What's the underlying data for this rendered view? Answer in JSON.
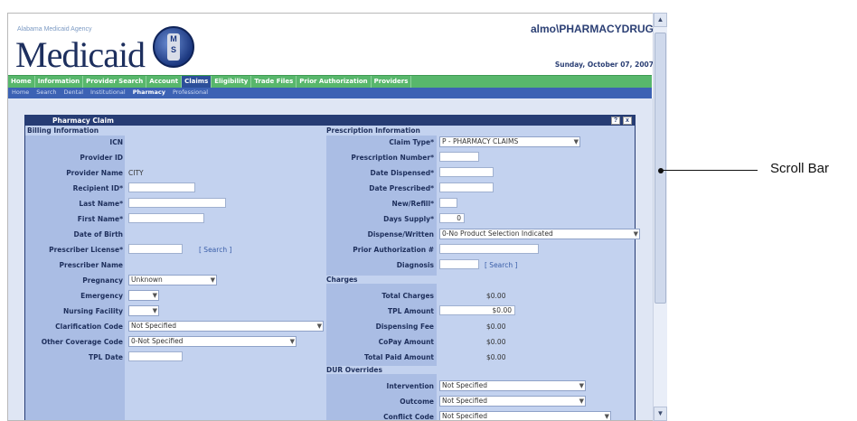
{
  "header": {
    "agency": "Alabama Medicaid Agency",
    "logo": "Medicaid",
    "seal_letters": "M S",
    "user": "almo\\PHARMACYDRUG",
    "date": "Sunday, October 07, 2007"
  },
  "nav": {
    "items": [
      "Home",
      "Information",
      "Provider Search",
      "Account",
      "Claims",
      "Eligibility",
      "Trade Files",
      "Prior Authorization",
      "Providers"
    ],
    "active": "Claims"
  },
  "subnav": {
    "items": [
      "Home",
      "Search",
      "Dental",
      "Institutional",
      "Pharmacy",
      "Professional"
    ],
    "active": "Pharmacy"
  },
  "panel": {
    "title": "Pharmacy Claim",
    "help_icon": "?",
    "close_icon": "x"
  },
  "billing": {
    "heading": "Billing Information",
    "icn_label": "ICN",
    "provider_id_label": "Provider ID",
    "provider_name_label": "Provider Name",
    "provider_name_value": "CITY",
    "recipient_id_label": "Recipient ID*",
    "last_name_label": "Last Name*",
    "first_name_label": "First Name*",
    "dob_label": "Date of Birth",
    "prescriber_license_label": "Prescriber License*",
    "search_link": "[ Search ]",
    "prescriber_name_label": "Prescriber Name",
    "pregnancy_label": "Pregnancy",
    "pregnancy_value": "Unknown",
    "emergency_label": "Emergency",
    "nursing_label": "Nursing Facility",
    "clarification_label": "Clarification Code",
    "clarification_value": "Not Specified",
    "other_coverage_label": "Other Coverage Code",
    "other_coverage_value": "0-Not Specified",
    "tpl_date_label": "TPL Date"
  },
  "prescription": {
    "heading": "Prescription Information",
    "claim_type_label": "Claim Type*",
    "claim_type_value": "P - PHARMACY CLAIMS",
    "rx_number_label": "Prescription Number*",
    "date_dispensed_label": "Date Dispensed*",
    "date_prescribed_label": "Date Prescribed*",
    "new_refill_label": "New/Refill*",
    "days_supply_label": "Days Supply*",
    "days_supply_value": "0",
    "dispense_label": "Dispense/Written",
    "dispense_value": "0-No Product Selection Indicated",
    "prior_auth_label": "Prior Authorization #",
    "diagnosis_label": "Diagnosis",
    "search_link": "[ Search ]"
  },
  "charges": {
    "heading": "Charges",
    "total_label": "Total Charges",
    "total_value": "$0.00",
    "tpl_label": "TPL Amount",
    "tpl_value": "$0.00",
    "dispensing_label": "Dispensing Fee",
    "dispensing_value": "$0.00",
    "copay_label": "CoPay Amount",
    "copay_value": "$0.00",
    "paid_label": "Total Paid Amount",
    "paid_value": "$0.00"
  },
  "dur": {
    "heading": "DUR Overrides",
    "intervention_label": "Intervention",
    "intervention_value": "Not Specified",
    "outcome_label": "Outcome",
    "outcome_value": "Not Specified",
    "conflict_label": "Conflict Code",
    "conflict_value": "Not Specified"
  },
  "annotation": {
    "label": "Scroll Bar"
  },
  "colors": {
    "nav_green": "#58b76c",
    "subnav_blue": "#3c62b4",
    "panel_bg": "#c3d2ef",
    "title_bar": "#263c74"
  }
}
